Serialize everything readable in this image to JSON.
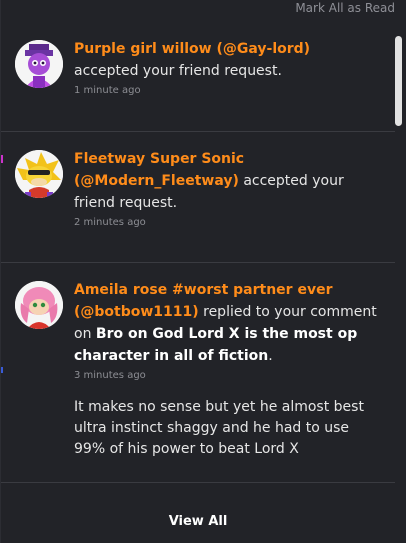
{
  "header": {
    "mark_all_label": "Mark All as Read"
  },
  "notifications": [
    {
      "avatar_icon": "purple-character-avatar",
      "user_label": "Purple girl willow (@Gay-lord)",
      "action": "accepted your friend request.",
      "time": "1 minute ago"
    },
    {
      "avatar_icon": "yellow-sonic-avatar",
      "user_label": "Fleetway Super Sonic (@Modern_Fleetway)",
      "action": "accepted your friend request.",
      "time": "2 minutes ago"
    },
    {
      "avatar_icon": "pink-hedgehog-avatar",
      "user_label": "Ameila rose #worst partner ever (@botbow1111)",
      "action": "replied to your comment on",
      "post_title": "Bro on God Lord X is the most op character in all of fiction",
      "post_suffix": ".",
      "time": "3 minutes ago",
      "reply_text": "It makes no sense but yet he almost best ultra instinct shaggy and he had to use 99% of his power to beat Lord X"
    }
  ],
  "footer": {
    "view_all_label": "View All"
  },
  "colors": {
    "username": "#ff8c1a",
    "background": "#222328",
    "divider": "#3a3b41"
  }
}
